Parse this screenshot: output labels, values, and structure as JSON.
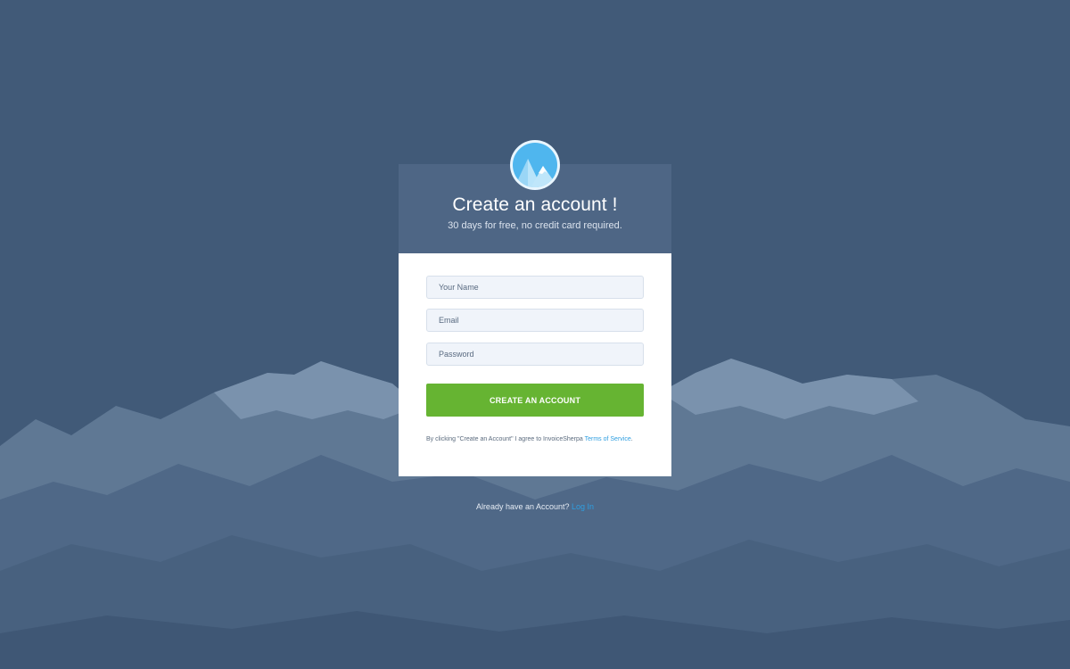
{
  "header": {
    "title": "Create an account !",
    "subtitle": "30 days for free, no credit card required."
  },
  "form": {
    "name_placeholder": "Your Name",
    "email_placeholder": "Email",
    "password_placeholder": "Password",
    "submit_label": "CREATE AN ACCOUNT",
    "terms_prefix": "By clicking \"Create an Account\" I agree to InvoiceSherpa ",
    "terms_link": "Terms of Service",
    "terms_suffix": "."
  },
  "footer": {
    "prompt": "Already have an Account? ",
    "login_link": "Log In"
  },
  "icons": {
    "logo": "mountain-logo-icon"
  },
  "colors": {
    "background": "#415a78",
    "card_header": "#4e6685",
    "primary_button": "#66b432",
    "link": "#2e9ee0",
    "logo_sky": "#4fb6ee",
    "logo_mountain": "#9ad6f6"
  }
}
